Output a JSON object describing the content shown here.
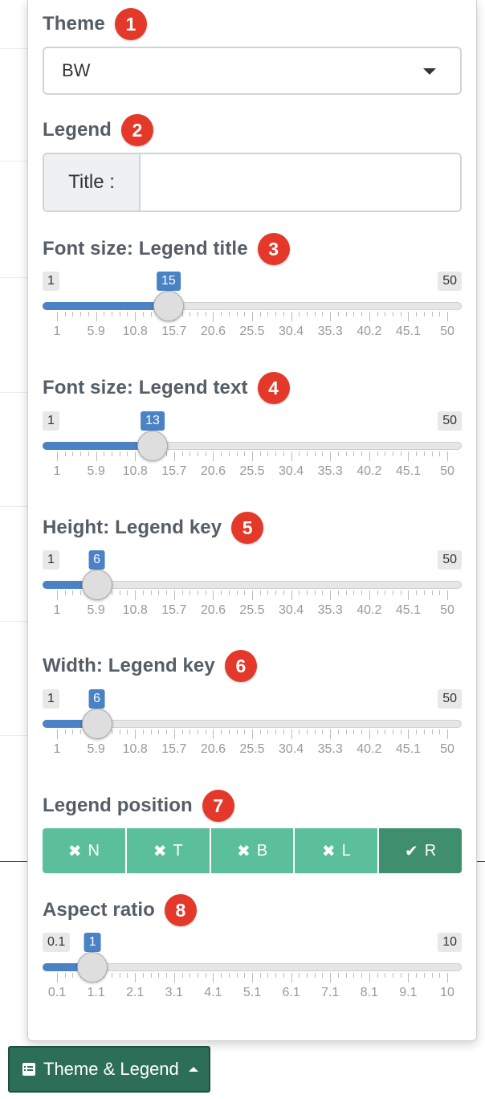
{
  "theme": {
    "label": "Theme",
    "badge": "1",
    "selected": "BW"
  },
  "legend": {
    "label": "Legend",
    "badge": "2",
    "title_addon": "Title :",
    "title_value": ""
  },
  "sliders": [
    {
      "label": "Font size: Legend title",
      "badge": "3",
      "min": "1",
      "max": "50",
      "value": "15",
      "minv": 1,
      "maxv": 50,
      "val": 15,
      "ticks": [
        "1",
        "5.9",
        "10.8",
        "15.7",
        "20.6",
        "25.5",
        "30.4",
        "35.3",
        "40.2",
        "45.1",
        "50"
      ]
    },
    {
      "label": "Font size: Legend text",
      "badge": "4",
      "min": "1",
      "max": "50",
      "value": "13",
      "minv": 1,
      "maxv": 50,
      "val": 13,
      "ticks": [
        "1",
        "5.9",
        "10.8",
        "15.7",
        "20.6",
        "25.5",
        "30.4",
        "35.3",
        "40.2",
        "45.1",
        "50"
      ]
    },
    {
      "label": "Height: Legend key",
      "badge": "5",
      "min": "1",
      "max": "50",
      "value": "6",
      "minv": 1,
      "maxv": 50,
      "val": 6,
      "ticks": [
        "1",
        "5.9",
        "10.8",
        "15.7",
        "20.6",
        "25.5",
        "30.4",
        "35.3",
        "40.2",
        "45.1",
        "50"
      ]
    },
    {
      "label": "Width: Legend key",
      "badge": "6",
      "min": "1",
      "max": "50",
      "value": "6",
      "minv": 1,
      "maxv": 50,
      "val": 6,
      "ticks": [
        "1",
        "5.9",
        "10.8",
        "15.7",
        "20.6",
        "25.5",
        "30.4",
        "35.3",
        "40.2",
        "45.1",
        "50"
      ]
    }
  ],
  "position": {
    "label": "Legend position",
    "badge": "7",
    "options": [
      {
        "label": "N",
        "icon": "✖",
        "selected": false
      },
      {
        "label": "T",
        "icon": "✖",
        "selected": false
      },
      {
        "label": "B",
        "icon": "✖",
        "selected": false
      },
      {
        "label": "L",
        "icon": "✖",
        "selected": false
      },
      {
        "label": "R",
        "icon": "✔",
        "selected": true
      }
    ]
  },
  "aspect": {
    "label": "Aspect ratio",
    "badge": "8",
    "min": "0.1",
    "max": "10",
    "value": "1",
    "minv": 0.1,
    "maxv": 10,
    "val": 1,
    "ticks": [
      "0.1",
      "1.1",
      "2.1",
      "3.1",
      "4.1",
      "5.1",
      "6.1",
      "7.1",
      "8.1",
      "9.1",
      "10"
    ]
  },
  "toggle": {
    "label": "Theme & Legend"
  },
  "colors": {
    "badge": "#e4382a",
    "slider": "#4a82c5",
    "button": "#5bbf9c",
    "button_active": "#3f8f6e",
    "toggle": "#2d6e58"
  }
}
